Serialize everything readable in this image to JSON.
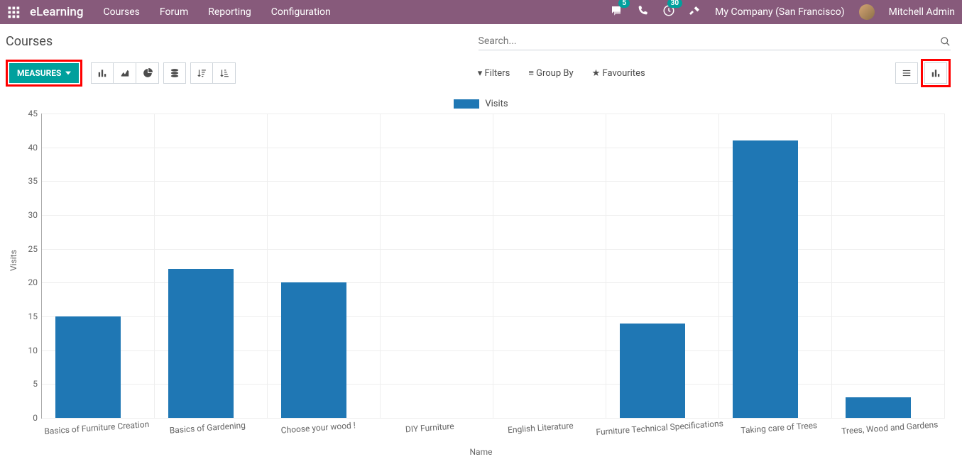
{
  "header": {
    "brand": "eLearning",
    "menu": [
      "Courses",
      "Forum",
      "Reporting",
      "Configuration"
    ],
    "chat_badge": "5",
    "clock_badge": "30",
    "company": "My Company (San Francisco)",
    "user": "Mitchell Admin"
  },
  "page": {
    "title": "Courses",
    "search_placeholder": "Search..."
  },
  "toolbar": {
    "measures": "MEASURES",
    "filters": "Filters",
    "group_by": "Group By",
    "favourites": "Favourites"
  },
  "chart_data": {
    "type": "bar",
    "title": "",
    "legend": "Visits",
    "xlabel": "Name",
    "ylabel": "Visits",
    "ylim": [
      0,
      45
    ],
    "yticks": [
      0,
      5,
      10,
      15,
      20,
      25,
      30,
      35,
      40,
      45
    ],
    "categories": [
      "Basics of Furniture Creation",
      "Basics of Gardening",
      "Choose your wood !",
      "DIY Furniture",
      "English Literature",
      "Furniture Technical Specifications",
      "Taking care of Trees",
      "Trees, Wood and Gardens"
    ],
    "values": [
      15,
      22,
      20,
      0,
      0,
      14,
      41,
      3
    ]
  }
}
